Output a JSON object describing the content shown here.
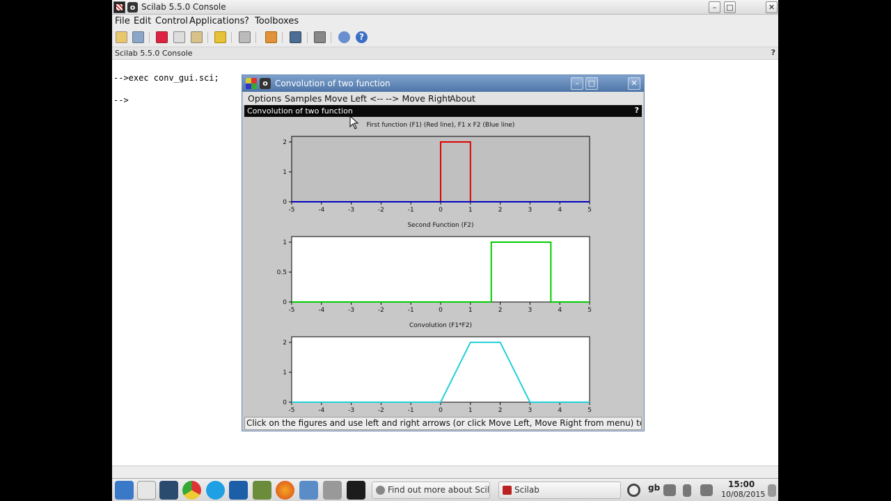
{
  "console_window": {
    "title": "Scilab 5.5.0 Console",
    "menu": [
      "File",
      "Edit",
      "Control",
      "Applications",
      "?",
      "Toolboxes"
    ],
    "doc_title": "Scilab 5.5.0 Console",
    "help_mark": "?",
    "lines": [
      "-->exec conv_gui.sci;",
      "-->"
    ]
  },
  "dialog": {
    "title": "Convolution of two function",
    "menu": [
      "Options",
      "Samples",
      "Move Left <--",
      "--> Move Right",
      "About"
    ],
    "header": "Convolution of two function",
    "help_mark": "?",
    "status": "Click on the figures and use left and right arrows (or click Move Left, Move Right from menu) to m"
  },
  "chart_data": [
    {
      "type": "line",
      "title": "First  function (F1) (Red line), F1 x F2 (Blue line)",
      "xlim": [
        -5,
        5
      ],
      "ylim": [
        0,
        2
      ],
      "xticks": [
        -5,
        -4,
        -3,
        -2,
        -1,
        0,
        1,
        2,
        3,
        4,
        5
      ],
      "yticks": [
        0,
        1,
        2
      ],
      "background": "#c0c0c0",
      "series": [
        {
          "color": "#e00000",
          "x": [
            -5,
            0,
            0,
            1,
            1,
            5
          ],
          "y": [
            0,
            0,
            2,
            2,
            0,
            0
          ]
        },
        {
          "color": "#0000c0",
          "x": [
            -5,
            5
          ],
          "y": [
            0,
            0
          ]
        }
      ]
    },
    {
      "type": "line",
      "title": "Second Function (F2)",
      "xlim": [
        -5,
        5
      ],
      "ylim": [
        0,
        1
      ],
      "xticks": [
        -5,
        -4,
        -3,
        -2,
        -1,
        0,
        1,
        2,
        3,
        4,
        5
      ],
      "yticks": [
        0,
        0.5,
        1
      ],
      "background": "#ffffff",
      "series": [
        {
          "color": "#00cc00",
          "x": [
            -5,
            1.7,
            1.7,
            3.7,
            3.7,
            5
          ],
          "y": [
            0,
            0,
            1,
            1,
            0,
            0
          ]
        }
      ]
    },
    {
      "type": "line",
      "title": "Convolution (F1*F2)",
      "xlim": [
        -5,
        5
      ],
      "ylim": [
        0,
        2
      ],
      "xticks": [
        -5,
        -4,
        -3,
        -2,
        -1,
        0,
        1,
        2,
        3,
        4,
        5
      ],
      "yticks": [
        0,
        1,
        2
      ],
      "background": "#ffffff",
      "series": [
        {
          "color": "#22d0d8",
          "x": [
            -5,
            0,
            1,
            2,
            3,
            5
          ],
          "y": [
            0,
            0,
            2,
            2,
            0,
            0
          ]
        }
      ]
    }
  ],
  "taskbar": {
    "find_out": "Find out more about Scilab",
    "scilab": "Scilab",
    "lang": "gb",
    "time": "15:00",
    "date": "10/08/2015"
  }
}
